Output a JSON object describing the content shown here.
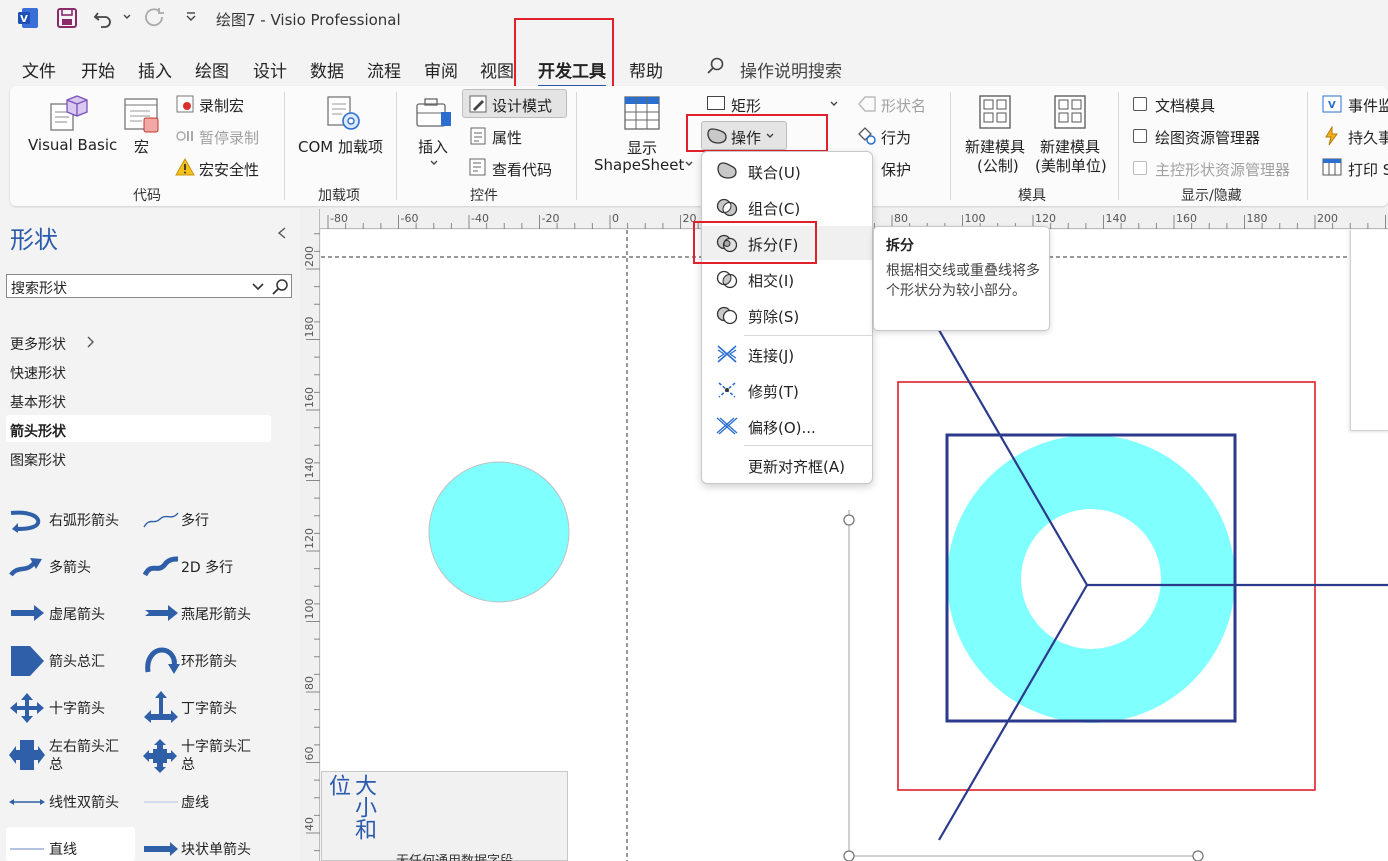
{
  "titlebar": {
    "app_icon": "visio-icon",
    "title": "绘图7  -  Visio Professional"
  },
  "tabs": [
    "文件",
    "开始",
    "插入",
    "绘图",
    "设计",
    "数据",
    "流程",
    "审阅",
    "视图",
    "开发工具",
    "帮助"
  ],
  "active_tab": "开发工具",
  "tell_me": "操作说明搜索",
  "ribbon": {
    "code": {
      "visual_basic": "Visual Basic",
      "macros": "宏",
      "record_macro": "录制宏",
      "pause_recording": "暂停录制",
      "macro_security": "宏安全性",
      "group": "代码"
    },
    "addins": {
      "com_addins": "COM 加载项",
      "group": "加载项"
    },
    "controls": {
      "insert": "插入",
      "design_mode": "设计模式",
      "properties": "属性",
      "view_code": "查看代码",
      "group": "控件"
    },
    "shape_design": {
      "show_shapesheet_1": "显示",
      "show_shapesheet_2": "ShapeSheet",
      "rectangle": "矩形",
      "operations": "操作",
      "shape_name": "形状名",
      "behavior": "行为",
      "protection": "保护"
    },
    "stencil": {
      "new_stencil_metric_1": "新建模具",
      "new_stencil_metric_2": "(公制)",
      "new_stencil_us_1": "新建模具",
      "new_stencil_us_2": "(美制单位)",
      "group": "模具"
    },
    "show_hide": {
      "document_stencil": "文档模具",
      "drawing_explorer": "绘图资源管理器",
      "master_explorer": "主控形状资源管理器",
      "group": "显示/隐藏"
    },
    "right_cut": {
      "event_monitor": "事件监",
      "persistent": "持久事",
      "print": "打印 S"
    }
  },
  "operations_menu": {
    "items": [
      {
        "label": "联合(U)",
        "icon": "union-icon"
      },
      {
        "label": "组合(C)",
        "icon": "combine-icon"
      },
      {
        "label": "拆分(F)",
        "icon": "fragment-icon"
      },
      {
        "label": "相交(I)",
        "icon": "intersect-icon"
      },
      {
        "label": "剪除(S)",
        "icon": "subtract-icon"
      },
      {
        "label": "连接(J)",
        "icon": "join-icon"
      },
      {
        "label": "修剪(T)",
        "icon": "trim-icon"
      },
      {
        "label": "偏移(O)...",
        "icon": "offset-icon"
      },
      {
        "label": "更新对齐框(A)",
        "icon": ""
      }
    ],
    "highlighted": "拆分(F)"
  },
  "tooltip": {
    "title": "拆分",
    "body": "根据相交线或重叠线将多个形状分为较小部分。"
  },
  "shapes_pane": {
    "title": "形状",
    "search_placeholder": "搜索形状",
    "nav": [
      "更多形状",
      "快速形状",
      "基本形状",
      "箭头形状",
      "图案形状"
    ],
    "selected_nav": "箭头形状",
    "items": [
      "右弧形箭头",
      "多行",
      "多箭头",
      "2D 多行",
      "虚尾箭头",
      "燕尾形箭头",
      "箭头总汇",
      "环形箭头",
      "十字箭头",
      "丁字箭头",
      "左右箭头汇总",
      "十字箭头汇总",
      "线性双箭头",
      "虚线",
      "直线",
      "块状单箭头"
    ]
  },
  "rulers": {
    "h_ticks": [
      "-80",
      "-60",
      "-40",
      "-20",
      "0",
      "20",
      "40",
      "60",
      "80",
      "100",
      "120",
      "140",
      "160",
      "180",
      "200"
    ],
    "v_ticks": [
      "200",
      "180",
      "160",
      "140",
      "120",
      "100",
      "80",
      "60",
      "40"
    ]
  },
  "canvas": {
    "size_panel_title": "大小和位",
    "size_panel_text": "无任何通用数据字段"
  },
  "colors": {
    "accent": "#2a5aad",
    "cyan": "#80ffff",
    "highlight_red": "#e0202a",
    "shape_stroke": "#2b3a8c"
  }
}
